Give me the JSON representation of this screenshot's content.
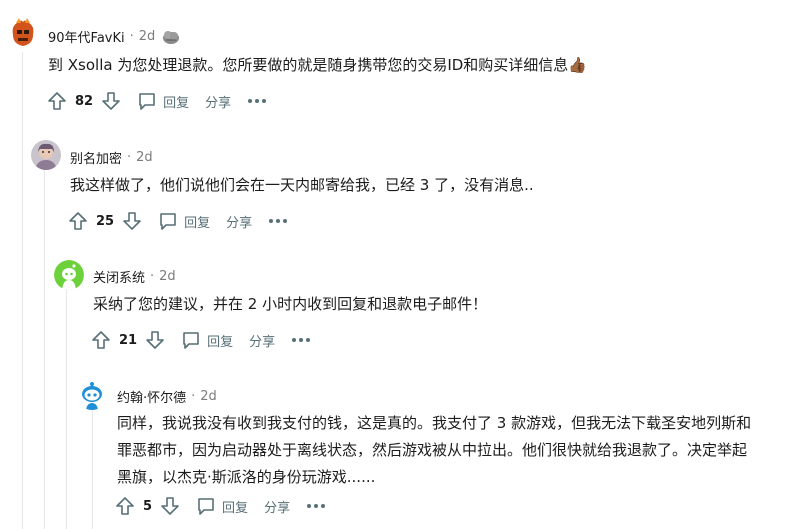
{
  "comments": [
    {
      "user": "90年代FavKi",
      "time": "2d",
      "text_lines": [
        "到 Xsolla 为您处理退款。您所要做的就是随身携带您的交易ID和购买详细信息👍🏾"
      ],
      "score": "82",
      "reply_label": "回复",
      "share_label": "分享"
    },
    {
      "user": "别名加密",
      "time": "2d",
      "text_lines": [
        "我这样做了，他们说他们会在一天内邮寄给我，已经 3 了，没有消息.."
      ],
      "score": "25",
      "reply_label": "回复",
      "share_label": "分享"
    },
    {
      "user": "关闭系统",
      "time": "2d",
      "text_lines": [
        "采纳了您的建议，并在 2 小时内收到回复和退款电子邮件！"
      ],
      "score": "21",
      "reply_label": "回复",
      "share_label": "分享"
    },
    {
      "user": "约翰·怀尔德",
      "time": "2d",
      "text_lines": [
        "同样，我说我没有收到我支付的钱，这是真的。我支付了 3 款游戏，但我无法下载圣安地列斯和",
        "罪恶都市，因为启动器处于离线状态，然后游戏被从中拉出。他们很快就给我退款了。决定举起",
        "黑旗，以杰克·斯派洛的身份玩游戏......"
      ],
      "score": "5",
      "reply_label": "回复",
      "share_label": "分享"
    }
  ],
  "colors": {
    "text": "#1c1c1c",
    "meta": "#7c7c7c",
    "action": "#576f76",
    "thread_line": "#e5e7ea"
  }
}
